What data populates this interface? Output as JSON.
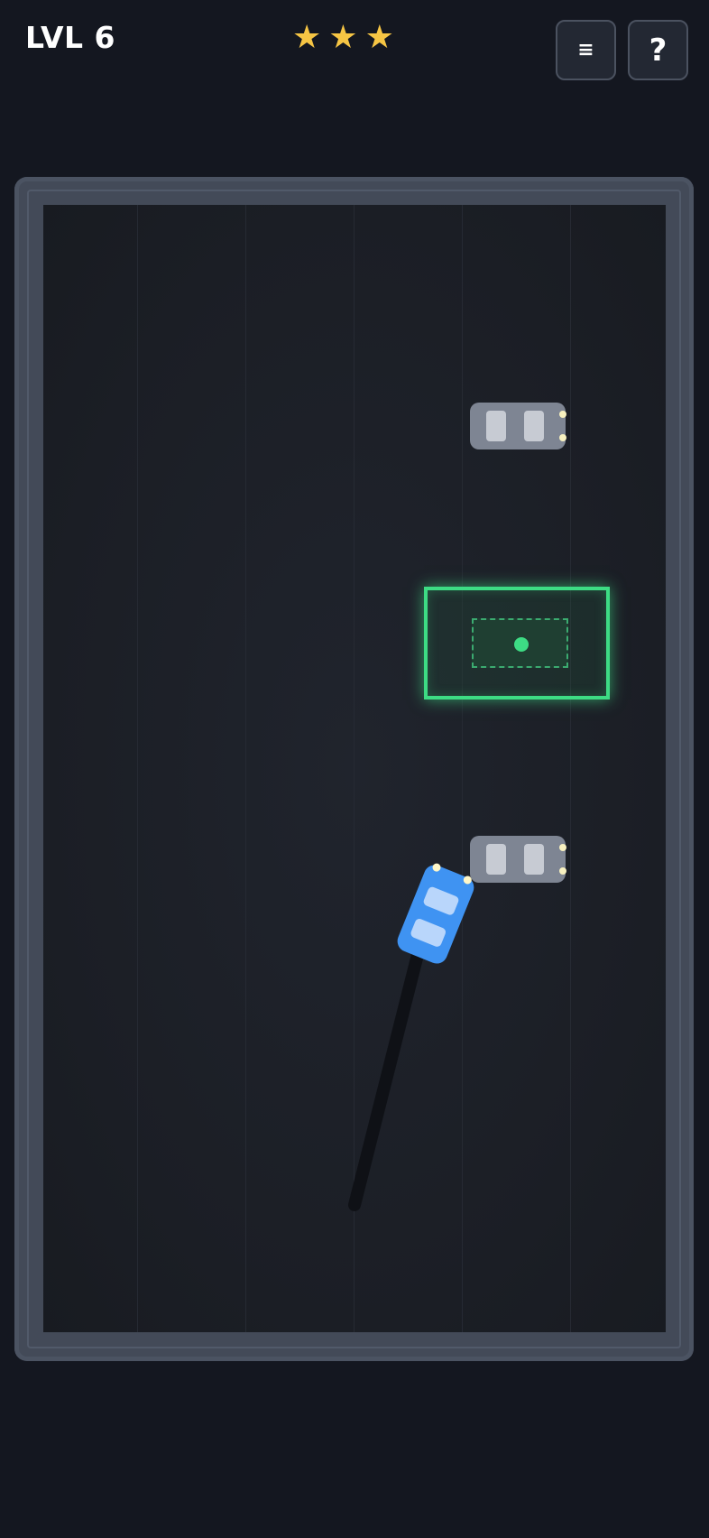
{
  "hud": {
    "level_label": "LVL 6",
    "stars": [
      "★",
      "★",
      "★"
    ],
    "menu_label": "≡",
    "help_label": "?"
  },
  "game": {
    "player_car_color": "#3f93f2",
    "parked_car_color": "#7e8593",
    "target_color": "#3ddc84",
    "wall_color": "#434a58",
    "background_color": "#141720"
  }
}
